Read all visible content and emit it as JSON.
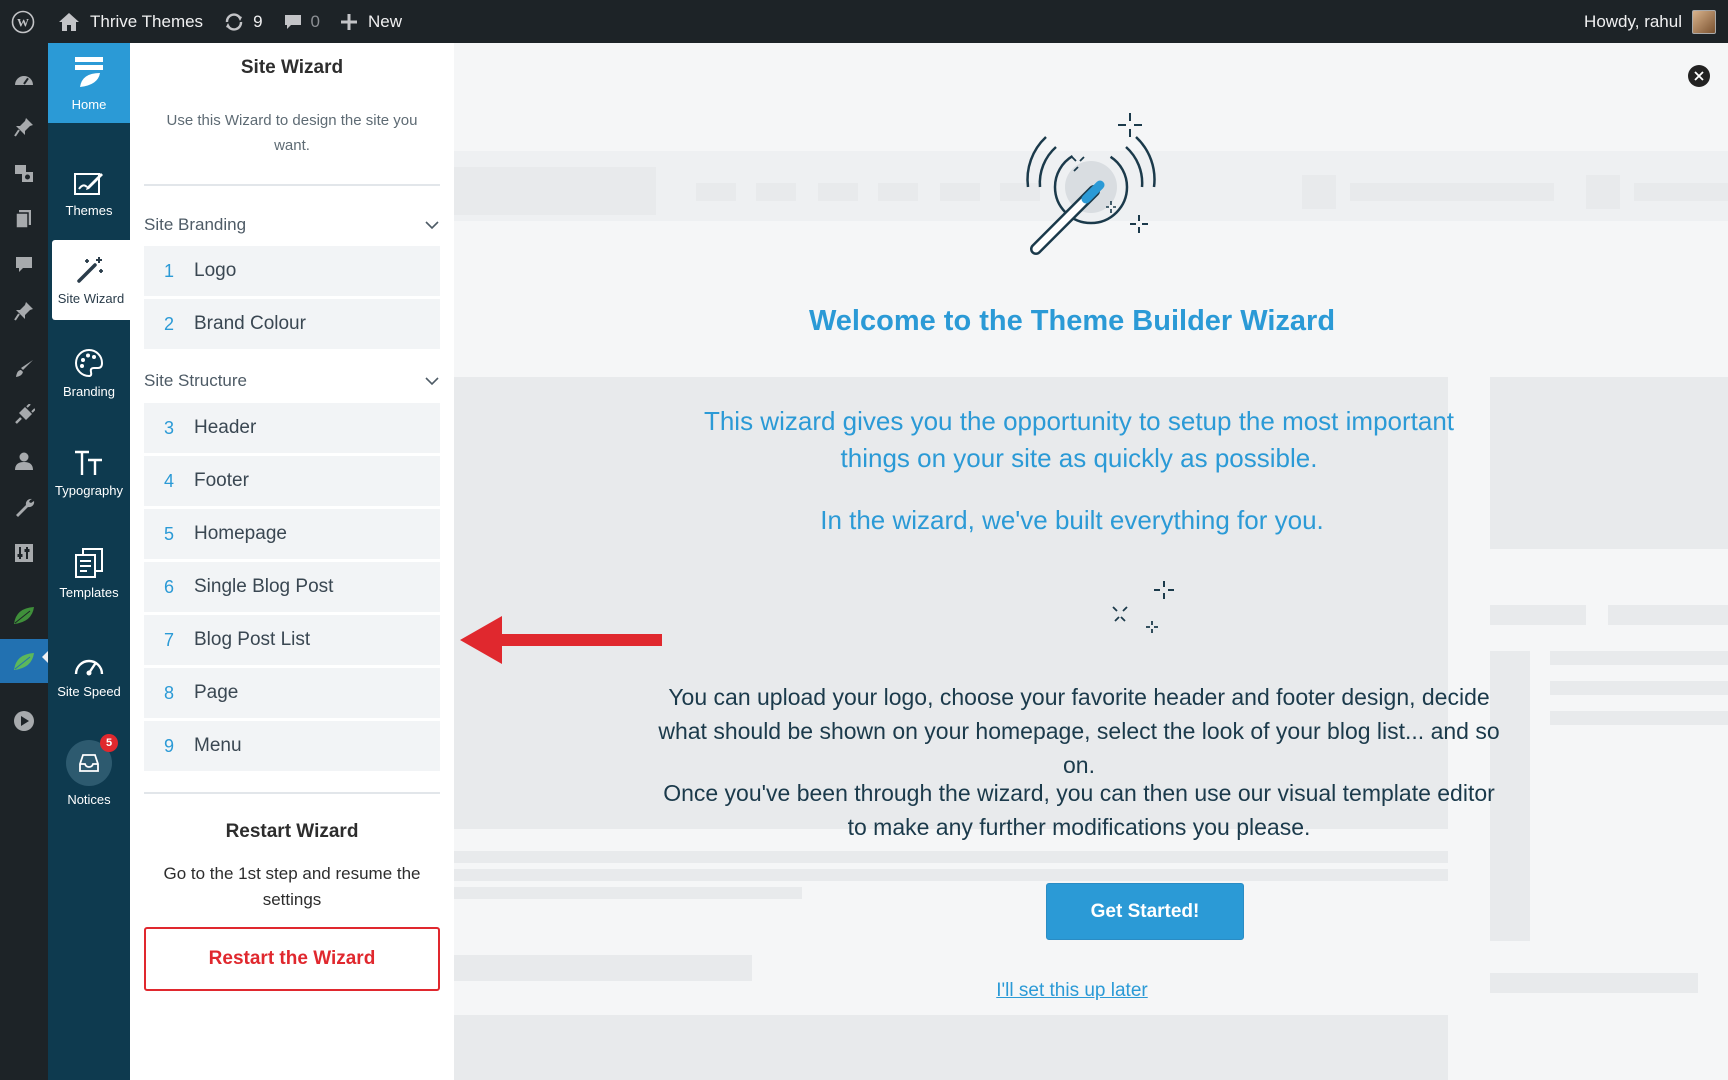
{
  "adminbar": {
    "site_name": "Thrive Themes",
    "updates_count": "9",
    "comments_count": "0",
    "new_label": "New",
    "greeting": "Howdy, rahul"
  },
  "tnav": {
    "home": "Home",
    "themes": "Themes",
    "site_wizard": "Site Wizard",
    "branding": "Branding",
    "typography": "Typography",
    "templates": "Templates",
    "site_speed": "Site Speed",
    "notices": "Notices",
    "notices_badge": "5"
  },
  "panel": {
    "title": "Site Wizard",
    "description": "Use this Wizard to design the site you want.",
    "sections": [
      {
        "title": "Site Branding",
        "steps": [
          {
            "num": "1",
            "label": "Logo"
          },
          {
            "num": "2",
            "label": "Brand Colour"
          }
        ]
      },
      {
        "title": "Site Structure",
        "steps": [
          {
            "num": "3",
            "label": "Header"
          },
          {
            "num": "4",
            "label": "Footer"
          },
          {
            "num": "5",
            "label": "Homepage"
          },
          {
            "num": "6",
            "label": "Single Blog Post"
          },
          {
            "num": "7",
            "label": "Blog Post List"
          },
          {
            "num": "8",
            "label": "Page"
          },
          {
            "num": "9",
            "label": "Menu"
          }
        ]
      }
    ],
    "restart_title": "Restart Wizard",
    "restart_description": "Go to the 1st step and resume the settings",
    "restart_button": "Restart the Wizard"
  },
  "main": {
    "welcome_title": "Welcome to the Theme Builder Wizard",
    "intro_1": "This wizard gives you the opportunity to setup the most important things on your site as quickly as possible.",
    "intro_2": "In the wizard, we've built everything for you.",
    "body_1": "You can upload your logo, choose your favorite header and footer design, decide what should be shown on your homepage, select the look of your blog list... and so on.",
    "body_2": "Once you've been through the wizard, you can then use our visual template editor to make any further modifications you please.",
    "get_started": "Get Started!",
    "later_link": "I'll set this up later"
  },
  "colors": {
    "accent": "#2b9ad6",
    "danger": "#e0282e",
    "sidebar": "#0e3a4f",
    "adminbar": "#1d2327"
  }
}
